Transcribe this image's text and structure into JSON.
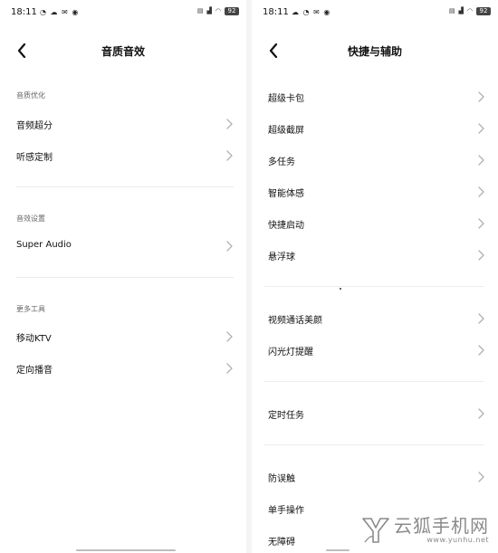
{
  "left": {
    "status": {
      "time": "18:11",
      "battery": "92"
    },
    "title": "音质音效",
    "sections": [
      {
        "title": "音质优化",
        "items": [
          "音频超分",
          "听感定制"
        ]
      },
      {
        "title": "音效设置",
        "items": [
          "Super Audio"
        ]
      },
      {
        "title": "更多工具",
        "items": [
          "移动KTV",
          "定向播音"
        ]
      }
    ]
  },
  "right": {
    "status": {
      "time": "18:11",
      "battery": "92"
    },
    "title": "快捷与辅助",
    "groups": [
      {
        "items": [
          "超级卡包",
          "超级截屏",
          "多任务",
          "智能体感",
          "快捷启动",
          "悬浮球"
        ]
      },
      {
        "items": [
          "视频通话美颜",
          "闪光灯提醒"
        ]
      },
      {
        "items": [
          "定时任务"
        ]
      },
      {
        "items": [
          "防误触",
          "单手操作",
          "无障碍"
        ]
      }
    ]
  },
  "watermark": {
    "text": "云狐手机网",
    "url": "www.yunhu.net"
  },
  "icons": {
    "back": "back-arrow-icon",
    "chevron": "chevron-right-icon",
    "logo": "yunhu-logo-icon"
  },
  "colors": {
    "background": "#ffffff",
    "text": "#111111",
    "section": "#666666",
    "chevron": "#b0b0b0",
    "divider": "#ececec"
  }
}
